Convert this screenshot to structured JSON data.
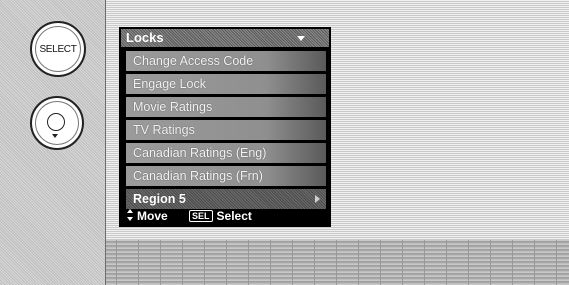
{
  "remote": {
    "select_label": "SELECT"
  },
  "menu": {
    "title": "Locks",
    "items": [
      {
        "label": "Change Access Code"
      },
      {
        "label": "Engage Lock"
      },
      {
        "label": "Movie Ratings"
      },
      {
        "label": "TV Ratings"
      },
      {
        "label": "Canadian Ratings (Eng)"
      },
      {
        "label": "Canadian Ratings (Frn)"
      },
      {
        "label": "Region 5"
      }
    ]
  },
  "footer": {
    "move_label": "Move",
    "sel_key": "SEL",
    "select_label": "Select"
  },
  "colors": {
    "panel_bg": "#000000",
    "item_bg": "#9b9b9b",
    "active_item_bg": "#5a5a5a",
    "text": "#ffffff"
  }
}
